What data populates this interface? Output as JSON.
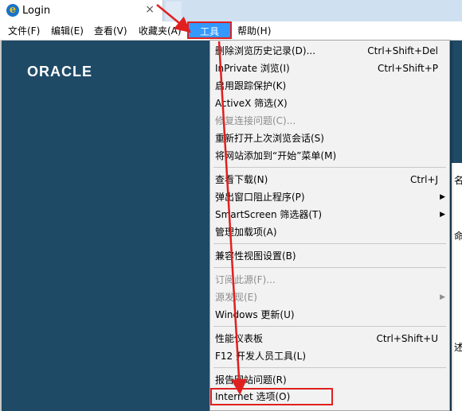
{
  "tab": {
    "title": "Login",
    "close": "×"
  },
  "menubar": {
    "items": [
      "文件(F)",
      "编辑(E)",
      "查看(V)",
      "收藏夹(A)",
      "工具(T)",
      "帮助(H)"
    ]
  },
  "page": {
    "logo": "ORACLE",
    "right_text": [
      "名",
      "命",
      "述"
    ]
  },
  "dropdown": {
    "items": [
      {
        "label": "删除浏览历史记录(D)...",
        "shortcut": "Ctrl+Shift+Del"
      },
      {
        "label": "InPrivate 浏览(I)",
        "shortcut": "Ctrl+Shift+P"
      },
      {
        "label": "启用跟踪保护(K)"
      },
      {
        "label": "ActiveX 筛选(X)"
      },
      {
        "label": "修复连接问题(C)...",
        "disabled": true
      },
      {
        "label": "重新打开上次浏览会话(S)"
      },
      {
        "label": "将网站添加到“开始”菜单(M)"
      },
      {
        "label": "查看下载(N)",
        "shortcut": "Ctrl+J"
      },
      {
        "label": "弹出窗口阻止程序(P)",
        "submenu": true
      },
      {
        "label": "SmartScreen 筛选器(T)",
        "submenu": true
      },
      {
        "label": "管理加载项(A)"
      },
      {
        "label": "兼容性视图设置(B)"
      },
      {
        "label": "订阅此源(F)...",
        "disabled": true
      },
      {
        "label": "源发现(E)",
        "disabled": true,
        "submenu": true
      },
      {
        "label": "Windows 更新(U)"
      },
      {
        "label": "性能仪表板",
        "shortcut": "Ctrl+Shift+U"
      },
      {
        "label": "F12 开发人员工具(L)"
      },
      {
        "label": "报告网站问题(R)"
      },
      {
        "label": "Internet 选项(O)"
      }
    ],
    "submenu_arrow": "▶"
  },
  "colors": {
    "highlight": "#3399ff",
    "annotation": "#e0201f",
    "page_bg": "#1e4a66"
  }
}
